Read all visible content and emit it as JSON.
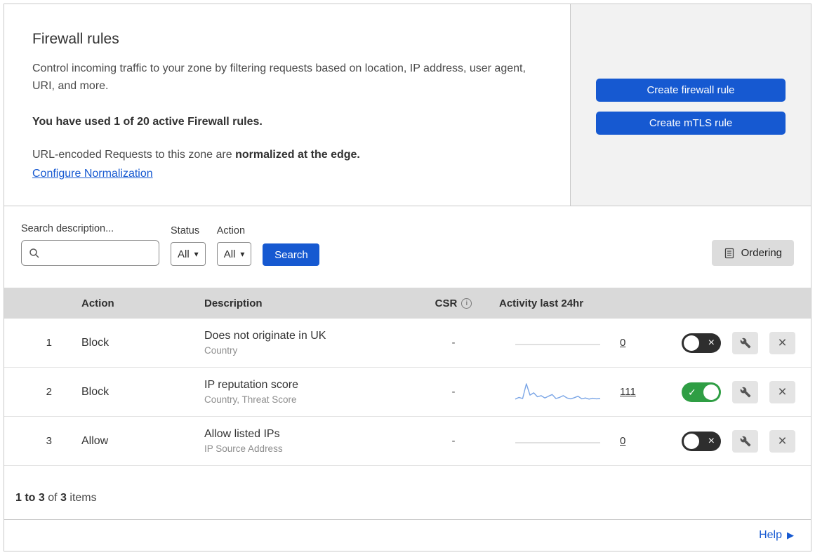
{
  "colors": {
    "accent_blue": "#1659d1",
    "toggle_green": "#2f9e44",
    "sparkline_blue": "#7aa5e6",
    "flatline_gray": "#d6d6d6",
    "panel_gray": "#f2f2f2",
    "table_header_gray": "#d9d9d9"
  },
  "icons": {
    "check": "✓",
    "cross": "×",
    "chevron_down": "▾",
    "help_arrow": "▶",
    "info": "i"
  },
  "header": {
    "title": "Firewall rules",
    "description": "Control incoming traffic to your zone by filtering requests based on location, IP address, user agent, URI, and more.",
    "usage": "You have used 1 of 20 active Firewall rules.",
    "normalization_prefix": "URL-encoded Requests to this zone are ",
    "normalization_bold": "normalized at the edge.",
    "normalization_link": "Configure Normalization",
    "create_firewall_button": "Create firewall rule",
    "create_mtls_button": "Create mTLS rule"
  },
  "filters": {
    "search_label": "Search description...",
    "status_label": "Status",
    "status_value": "All",
    "action_label": "Action",
    "action_value": "All",
    "search_button": "Search",
    "ordering_button": "Ordering"
  },
  "table": {
    "headers": {
      "action": "Action",
      "description": "Description",
      "csr": "CSR",
      "activity": "Activity last 24hr"
    },
    "rows": [
      {
        "num": "1",
        "action": "Block",
        "description": "Does not originate in UK",
        "criteria": "Country",
        "csr": "-",
        "activity_count": "0",
        "enabled": false,
        "sparkline": []
      },
      {
        "num": "2",
        "action": "Block",
        "description": "IP reputation score",
        "criteria": "Country, Threat Score",
        "csr": "-",
        "activity_count": "111",
        "enabled": true,
        "sparkline": [
          8,
          14,
          10,
          62,
          22,
          30,
          16,
          20,
          12,
          18,
          24,
          10,
          14,
          20,
          12,
          9,
          13,
          18,
          9,
          12,
          8,
          11,
          9,
          10
        ]
      },
      {
        "num": "3",
        "action": "Allow",
        "description": "Allow listed IPs",
        "criteria": "IP Source Address",
        "csr": "-",
        "activity_count": "0",
        "enabled": false,
        "sparkline": []
      }
    ]
  },
  "footer": {
    "range": "1 to 3",
    "of": "of",
    "total": "3",
    "items": "items"
  },
  "help": {
    "label": "Help"
  }
}
